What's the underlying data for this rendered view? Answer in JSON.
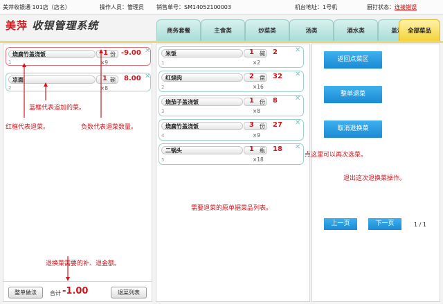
{
  "topbar": {
    "store": "美萍收银通 101店（店名）",
    "operator": "操作人员：管理员",
    "order": "销售单号：SM14052100003",
    "machine": "机台地址：1号机",
    "kitchen_label": "厨打状态：",
    "kitchen_link": "连接错误"
  },
  "brand": {
    "name_red": "美萍",
    "name_rest": " 收银管理系统"
  },
  "tabs": [
    "商务套餐",
    "主食类",
    "炒菜类",
    "汤类",
    "酒水类",
    "盖浇饭",
    "全部菜品"
  ],
  "active_tab": "全部菜品",
  "left_items": [
    {
      "name": "烧腐竹盖浇饭",
      "qty": "-1",
      "unit": "份",
      "price": "-9.00",
      "mult": "×9",
      "idx": "1",
      "border": "red"
    },
    {
      "name": "凉面",
      "qty": "1",
      "unit": "碗",
      "price": "8.00",
      "mult": "×8",
      "idx": "2",
      "border": "blue"
    }
  ],
  "mid_items": [
    {
      "name": "米饭",
      "qty": "1",
      "unit": "碗",
      "price": "2",
      "mult": "×2",
      "idx": "1"
    },
    {
      "name": "红烧肉",
      "qty": "2",
      "unit": "盘",
      "price": "32",
      "mult": "×16",
      "idx": "2"
    },
    {
      "name": "烧茄子盖浇饭",
      "qty": "1",
      "unit": "份",
      "price": "8",
      "mult": "×8",
      "idx": "3"
    },
    {
      "name": "烧腐竹盖浇饭",
      "qty": "3",
      "unit": "份",
      "price": "27",
      "mult": "×9",
      "idx": "4"
    },
    {
      "name": "二锅头",
      "qty": "1",
      "unit": "瓶",
      "price": "18",
      "mult": "×18",
      "idx": "5"
    }
  ],
  "right": {
    "btn_back": "返回点菜区",
    "btn_full": "整单退菜",
    "btn_cancel": "取消退换菜",
    "prev": "上一页",
    "next": "下一页",
    "page": "1 / 1"
  },
  "bottom": {
    "full_method": "整单做法",
    "total_label": "合计",
    "total_value": "-1.00",
    "list_btn": "退菜列表"
  },
  "annotations": {
    "a1": "蓝框代表追加的菜。",
    "a2": "红框代表退菜。",
    "a3": "负数代表退菜数量。",
    "a4": "点这里可以再次选菜。",
    "a5": "退出这次退换菜操作。",
    "a6": "需要退菜的原单据菜品列表。",
    "a7": "退换菜需要的补、退金额。"
  },
  "colors": {
    "accent_red": "#d0161c",
    "button_blue": "#1a8ad4",
    "card_border": "#9ed0c9",
    "tab_active": "#f4d33a"
  }
}
